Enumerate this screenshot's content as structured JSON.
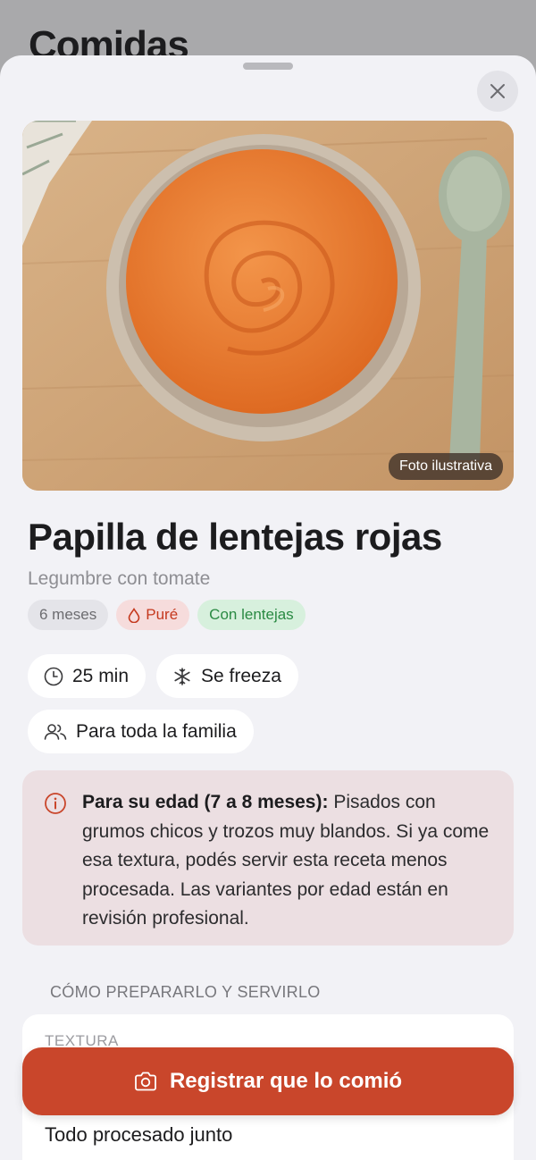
{
  "background": {
    "title": "Comidas"
  },
  "sheet": {
    "close_icon": "close-icon"
  },
  "hero": {
    "badge": "Foto ilustrativa"
  },
  "recipe": {
    "title": "Papilla de lentejas rojas",
    "subtitle": "Legumbre con tomate",
    "tags": {
      "age": "6 meses",
      "texture": "Puré",
      "legume": "Con lentejas"
    },
    "pills": {
      "time": "25 min",
      "freeze": "Se freeza",
      "family": "Para toda la familia"
    }
  },
  "notice": {
    "bold": "Para su edad (7 a 8 meses):",
    "text": " Pisados con grumos chicos y trozos muy blandos. Si ya come esa textura, podés servir esta receta menos procesada. Las variantes por edad están en revisión profesional."
  },
  "section": {
    "label": "CÓMO PREPARARLO Y SERVIRLO"
  },
  "card": {
    "label": "TEXTURA",
    "value": "Todo procesado junto"
  },
  "cta": {
    "label": "Registrar que lo comió"
  },
  "colors": {
    "accent": "#c9462b",
    "texture_tag": "#c5391e",
    "legume_tag": "#2a8a43",
    "notice_bg": "#ecdfe2"
  }
}
